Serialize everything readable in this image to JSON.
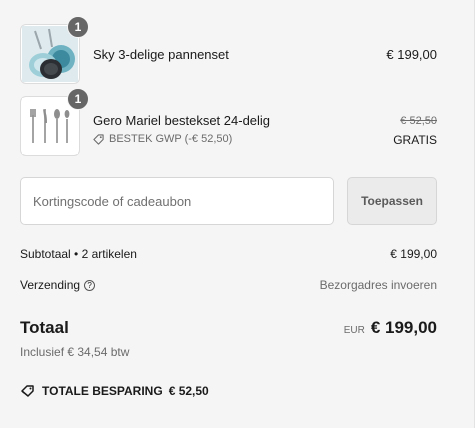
{
  "items": [
    {
      "name": "Sky 3-delige pannenset",
      "quantity": "1",
      "price": "€ 199,00",
      "image_icon": "cookware-set-icon"
    },
    {
      "name": "Gero Mariel bestekset 24-delig",
      "quantity": "1",
      "discount_label": "BESTEK GWP (-€ 52,50)",
      "original_price": "€ 52,50",
      "price": "GRATIS",
      "image_icon": "cutlery-set-icon"
    }
  ],
  "discount_form": {
    "placeholder": "Kortingscode of cadeaubon",
    "apply_label": "Toepassen"
  },
  "summary": {
    "subtotal_label": "Subtotaal • 2 artikelen",
    "subtotal_value": "€ 199,00",
    "shipping_label": "Verzending",
    "shipping_value": "Bezorgadres invoeren"
  },
  "total": {
    "label": "Totaal",
    "currency": "EUR",
    "amount": "€ 199,00",
    "tax_note": "Inclusief € 34,54 btw"
  },
  "savings": {
    "label": "TOTALE BESPARING",
    "amount": "€ 52,50",
    "icon": "tag-icon"
  }
}
